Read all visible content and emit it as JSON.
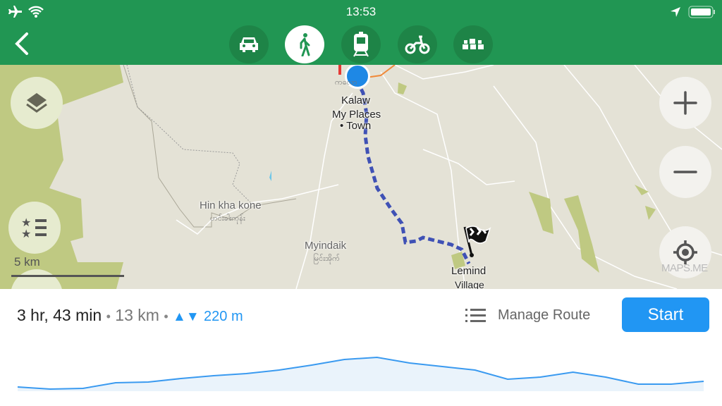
{
  "status_bar": {
    "time": "13:53",
    "icons": [
      "airplane-icon",
      "wifi-icon",
      "location-arrow-icon",
      "battery-icon"
    ]
  },
  "header": {
    "back_icon": "chevron-left-icon",
    "modes": [
      {
        "id": "car",
        "icon": "car-icon",
        "active": false
      },
      {
        "id": "walk",
        "icon": "pedestrian-icon",
        "active": true
      },
      {
        "id": "transit",
        "icon": "train-icon",
        "active": false
      },
      {
        "id": "bicycle",
        "icon": "bicycle-icon",
        "active": false
      },
      {
        "id": "taxi",
        "icon": "taxi-icon",
        "active": false
      }
    ]
  },
  "map": {
    "labels": {
      "kalaw": "Kalaw",
      "my_places": "My Places",
      "town": "• Town",
      "hin_kha_kone": "Hin kha kone",
      "hin_kha_kone_local": "ဟင်းခါးကုန်း",
      "myindaik": "Myindaik",
      "myindaik_local": "မြင်းအိုက်",
      "lemind": "Lemind",
      "village": "Village",
      "kalaw_local": "ကလော"
    },
    "scale": "5 km",
    "watermark": "MAPS.ME",
    "route_color": "#3f51b5",
    "position_color": "#1e88e5"
  },
  "route": {
    "time": "3 hr, 43 min",
    "distance": "13 km",
    "separator": "•",
    "elevation": "220 m",
    "manage_label": "Manage Route",
    "start_label": "Start",
    "accent": "#2196f3"
  },
  "elevation_profile": [
    3,
    0,
    1,
    9,
    10,
    15,
    19,
    22,
    27,
    34,
    42,
    45,
    37,
    32,
    27,
    14,
    17,
    24,
    17,
    7,
    7,
    11
  ]
}
